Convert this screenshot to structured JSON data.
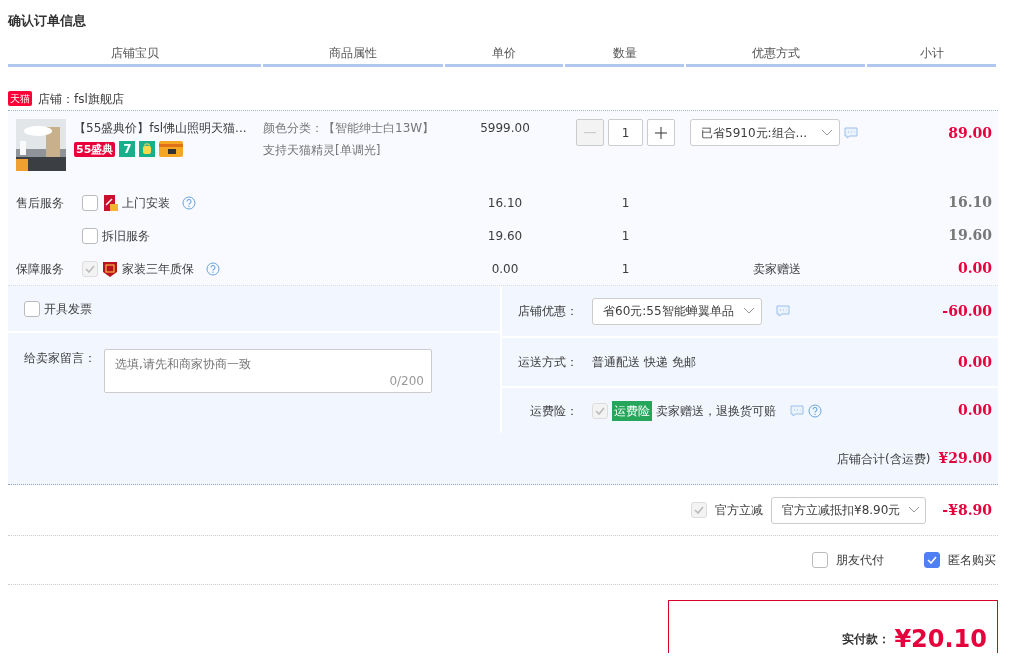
{
  "page_title": "确认订单信息",
  "columns": [
    "店铺宝贝",
    "商品属性",
    "单价",
    "数量",
    "优惠方式",
    "小计"
  ],
  "shop": {
    "platform_badge": "天猫",
    "label": "店铺：fsl旗舰店"
  },
  "item": {
    "title": "【55盛典价】fsl佛山照明天猫...",
    "badges": [
      {
        "kind": "festival",
        "label": "55盛典"
      },
      {
        "kind": "days",
        "label": "7"
      },
      {
        "kind": "bag"
      },
      {
        "kind": "card"
      }
    ],
    "props": [
      "颜色分类：【智能绅士白13W】",
      "支持天猫精灵[单调光]"
    ],
    "price": "5999.00",
    "quantity": "1",
    "minus_disabled": true,
    "promo": "已省5910元:组合...",
    "subtotal": "89.00"
  },
  "services": [
    {
      "group": "售后服务",
      "kind": "install",
      "name": "上门安装",
      "help": true,
      "checked": false,
      "disabled": false,
      "price": "16.10",
      "qty": "1",
      "subtotal": "16.10"
    },
    {
      "kind": "plain",
      "name": "拆旧服务",
      "help": false,
      "checked": false,
      "disabled": false,
      "price": "19.60",
      "qty": "1",
      "subtotal": "19.60"
    },
    {
      "group": "保障服务",
      "kind": "warranty",
      "name": "家装三年质保",
      "help": true,
      "checked": true,
      "disabled": true,
      "price": "0.00",
      "qty": "1",
      "promo": "卖家赠送",
      "subtotal": "0.00"
    }
  ],
  "invoice": {
    "label": "开具发票",
    "checked": false
  },
  "message": {
    "label": "给卖家留言：",
    "placeholder": "选填,请先和商家协商一致",
    "counter": "0/200"
  },
  "shop_discount": {
    "label": "店铺优惠：",
    "option": "省60元:55智能蝉翼单品",
    "amount": "-60.00"
  },
  "shipping": {
    "label": "运送方式：",
    "value": "普通配送 快递 免邮",
    "amount": "0.00"
  },
  "insurance": {
    "label": "运费险：",
    "checked": true,
    "disabled": true,
    "tag": "运费险",
    "text": "卖家赠送，退换货可赔",
    "amount": "0.00"
  },
  "shop_total": {
    "label": "店铺合计(含运费)",
    "amount": "¥29.00"
  },
  "official": {
    "checked": true,
    "disabled": true,
    "label": "官方立减",
    "option": "官方立减抵扣¥8.90元",
    "amount": "-¥8.90"
  },
  "options": [
    {
      "label": "朋友代付",
      "checked": false
    },
    {
      "label": "匿名购买",
      "checked": true
    }
  ],
  "payment": {
    "label": "实付款：",
    "amount": "¥20.10"
  }
}
